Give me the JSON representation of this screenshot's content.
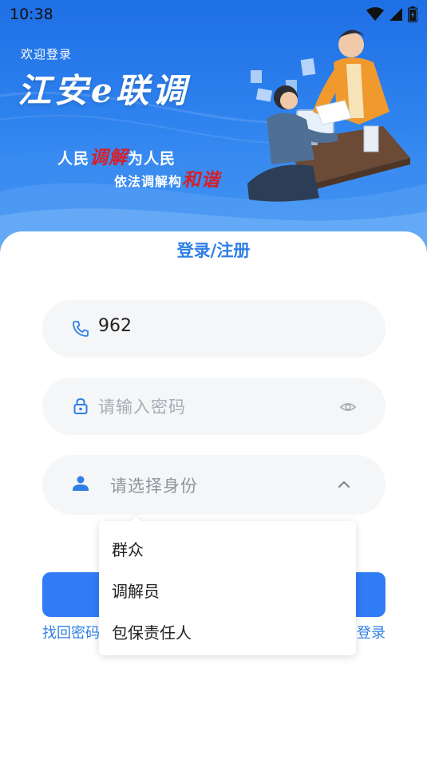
{
  "status_bar": {
    "time": "10:38",
    "icons": [
      "wifi-icon",
      "cell-signal-icon",
      "battery-icon"
    ]
  },
  "banner": {
    "welcome": "欢迎登录",
    "app_name": "江安e联调",
    "slogan_line1_part1": "人民",
    "slogan_line1_highlight": "调解",
    "slogan_line1_part2": "为人民",
    "slogan_line2_part1": "依法调解构",
    "slogan_line2_highlight": "和谐"
  },
  "form": {
    "title": "登录/注册",
    "phone": {
      "icon": "phone-icon",
      "value": "962"
    },
    "password": {
      "icon": "lock-icon",
      "placeholder": "请输入密码",
      "toggle_icon": "eye-icon"
    },
    "role": {
      "icon": "user-icon",
      "placeholder": "请选择身份",
      "toggle_icon": "chevron-up-icon"
    },
    "forgot_link": "找回密码",
    "register_link": "登录"
  },
  "role_dropdown": {
    "options": [
      "群众",
      "调解员",
      "包保责任人"
    ]
  },
  "colors": {
    "primary": "#2f7cf6",
    "accent_text": "#2f7fe6",
    "highlight_red": "#d5202b",
    "field_bg": "#f5f6f8"
  }
}
